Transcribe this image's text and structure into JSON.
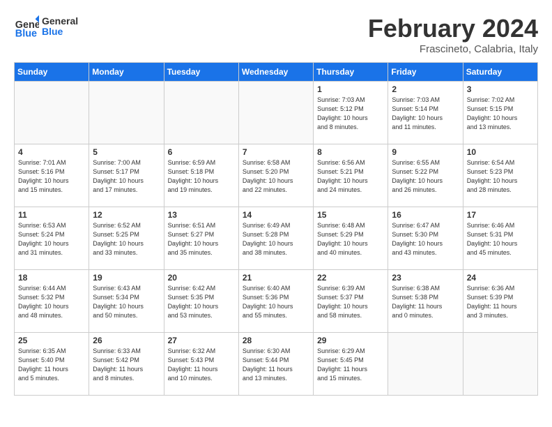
{
  "header": {
    "logo_text_general": "General",
    "logo_text_blue": "Blue",
    "month_title": "February 2024",
    "location": "Frascineto, Calabria, Italy"
  },
  "days_of_week": [
    "Sunday",
    "Monday",
    "Tuesday",
    "Wednesday",
    "Thursday",
    "Friday",
    "Saturday"
  ],
  "weeks": [
    [
      {
        "day": "",
        "empty": true
      },
      {
        "day": "",
        "empty": true
      },
      {
        "day": "",
        "empty": true
      },
      {
        "day": "",
        "empty": true
      },
      {
        "day": "1",
        "info": "Sunrise: 7:03 AM\nSunset: 5:12 PM\nDaylight: 10 hours\nand 8 minutes."
      },
      {
        "day": "2",
        "info": "Sunrise: 7:03 AM\nSunset: 5:14 PM\nDaylight: 10 hours\nand 11 minutes."
      },
      {
        "day": "3",
        "info": "Sunrise: 7:02 AM\nSunset: 5:15 PM\nDaylight: 10 hours\nand 13 minutes."
      }
    ],
    [
      {
        "day": "4",
        "info": "Sunrise: 7:01 AM\nSunset: 5:16 PM\nDaylight: 10 hours\nand 15 minutes."
      },
      {
        "day": "5",
        "info": "Sunrise: 7:00 AM\nSunset: 5:17 PM\nDaylight: 10 hours\nand 17 minutes."
      },
      {
        "day": "6",
        "info": "Sunrise: 6:59 AM\nSunset: 5:18 PM\nDaylight: 10 hours\nand 19 minutes."
      },
      {
        "day": "7",
        "info": "Sunrise: 6:58 AM\nSunset: 5:20 PM\nDaylight: 10 hours\nand 22 minutes."
      },
      {
        "day": "8",
        "info": "Sunrise: 6:56 AM\nSunset: 5:21 PM\nDaylight: 10 hours\nand 24 minutes."
      },
      {
        "day": "9",
        "info": "Sunrise: 6:55 AM\nSunset: 5:22 PM\nDaylight: 10 hours\nand 26 minutes."
      },
      {
        "day": "10",
        "info": "Sunrise: 6:54 AM\nSunset: 5:23 PM\nDaylight: 10 hours\nand 28 minutes."
      }
    ],
    [
      {
        "day": "11",
        "info": "Sunrise: 6:53 AM\nSunset: 5:24 PM\nDaylight: 10 hours\nand 31 minutes."
      },
      {
        "day": "12",
        "info": "Sunrise: 6:52 AM\nSunset: 5:25 PM\nDaylight: 10 hours\nand 33 minutes."
      },
      {
        "day": "13",
        "info": "Sunrise: 6:51 AM\nSunset: 5:27 PM\nDaylight: 10 hours\nand 35 minutes."
      },
      {
        "day": "14",
        "info": "Sunrise: 6:49 AM\nSunset: 5:28 PM\nDaylight: 10 hours\nand 38 minutes."
      },
      {
        "day": "15",
        "info": "Sunrise: 6:48 AM\nSunset: 5:29 PM\nDaylight: 10 hours\nand 40 minutes."
      },
      {
        "day": "16",
        "info": "Sunrise: 6:47 AM\nSunset: 5:30 PM\nDaylight: 10 hours\nand 43 minutes."
      },
      {
        "day": "17",
        "info": "Sunrise: 6:46 AM\nSunset: 5:31 PM\nDaylight: 10 hours\nand 45 minutes."
      }
    ],
    [
      {
        "day": "18",
        "info": "Sunrise: 6:44 AM\nSunset: 5:32 PM\nDaylight: 10 hours\nand 48 minutes."
      },
      {
        "day": "19",
        "info": "Sunrise: 6:43 AM\nSunset: 5:34 PM\nDaylight: 10 hours\nand 50 minutes."
      },
      {
        "day": "20",
        "info": "Sunrise: 6:42 AM\nSunset: 5:35 PM\nDaylight: 10 hours\nand 53 minutes."
      },
      {
        "day": "21",
        "info": "Sunrise: 6:40 AM\nSunset: 5:36 PM\nDaylight: 10 hours\nand 55 minutes."
      },
      {
        "day": "22",
        "info": "Sunrise: 6:39 AM\nSunset: 5:37 PM\nDaylight: 10 hours\nand 58 minutes."
      },
      {
        "day": "23",
        "info": "Sunrise: 6:38 AM\nSunset: 5:38 PM\nDaylight: 11 hours\nand 0 minutes."
      },
      {
        "day": "24",
        "info": "Sunrise: 6:36 AM\nSunset: 5:39 PM\nDaylight: 11 hours\nand 3 minutes."
      }
    ],
    [
      {
        "day": "25",
        "info": "Sunrise: 6:35 AM\nSunset: 5:40 PM\nDaylight: 11 hours\nand 5 minutes."
      },
      {
        "day": "26",
        "info": "Sunrise: 6:33 AM\nSunset: 5:42 PM\nDaylight: 11 hours\nand 8 minutes."
      },
      {
        "day": "27",
        "info": "Sunrise: 6:32 AM\nSunset: 5:43 PM\nDaylight: 11 hours\nand 10 minutes."
      },
      {
        "day": "28",
        "info": "Sunrise: 6:30 AM\nSunset: 5:44 PM\nDaylight: 11 hours\nand 13 minutes."
      },
      {
        "day": "29",
        "info": "Sunrise: 6:29 AM\nSunset: 5:45 PM\nDaylight: 11 hours\nand 15 minutes."
      },
      {
        "day": "",
        "empty": true
      },
      {
        "day": "",
        "empty": true
      }
    ]
  ]
}
